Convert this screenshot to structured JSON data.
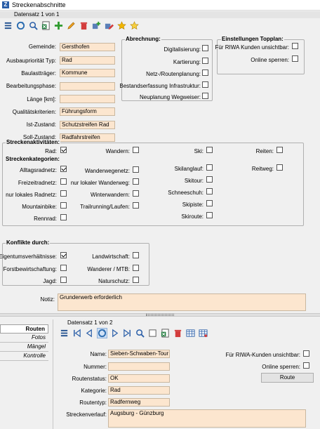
{
  "window": {
    "title": "Streckenabschnitte"
  },
  "top": {
    "record_indicator": "Datensatz 1 von 1",
    "toolbar_icons": [
      "menu-icon",
      "refresh-icon",
      "search-icon",
      "excel-export-icon",
      "add-icon",
      "edit-icon",
      "delete-icon",
      "add-plus-icon",
      "edit-pencil-icon",
      "star-icon",
      "star-outline-icon"
    ]
  },
  "form": {
    "gemeinde": {
      "label": "Gemeinde:",
      "value": "Gersthofen"
    },
    "ausbauprioritaet": {
      "label": "Ausbaupriorität Typ:",
      "value": "Rad"
    },
    "baulasttraeger": {
      "label": "Baulastträger:",
      "value": "Kommune"
    },
    "bearbeitungsphase": {
      "label": "Bearbeitungsphase:",
      "value": ""
    },
    "laenge": {
      "label": "Länge [km]:",
      "value": ""
    },
    "qualitaetskriterien": {
      "label": "Qualitätskriterien:",
      "value": "Führungsform"
    },
    "ist_zustand": {
      "label": "Ist-Zustand:",
      "value": "Schutzstreifen Rad"
    },
    "soll_zustand": {
      "label": "Soll-Zustand:",
      "value": "Radfahrstreifen"
    }
  },
  "abrechnung": {
    "title": "Abrechnung:",
    "items": [
      {
        "label": "Digitalisierung:",
        "checked": false
      },
      {
        "label": "Kartierung:",
        "checked": false
      },
      {
        "label": "Netz-/Routenplanung:",
        "checked": false
      },
      {
        "label": "Bestandserfassung Infrastruktur:",
        "checked": false
      },
      {
        "label": "Neuplanung Wegweiser:",
        "checked": false
      }
    ]
  },
  "toppland": {
    "title": "Einstellungen Topplan:",
    "items": [
      {
        "label": "Für RIWA Kunden unsichtbar:",
        "checked": false
      },
      {
        "label": "Online sperren:",
        "checked": false
      }
    ]
  },
  "streckenaktivitaeten": {
    "title": "Streckenaktivitäten:",
    "rad": {
      "label": "Rad:",
      "checked": true
    },
    "wandern": {
      "label": "Wandern:",
      "checked": false
    },
    "ski": {
      "label": "Ski:",
      "checked": false
    },
    "reiten": {
      "label": "Reiten:",
      "checked": false
    }
  },
  "streckenkategorien": {
    "title": "Streckenkategorien:",
    "col1": [
      {
        "label": "Alltagsradnetz:",
        "checked": true
      },
      {
        "label": "Freizeitradnetz:",
        "checked": false
      },
      {
        "label": "nur lokales Radnetz:",
        "checked": false
      },
      {
        "label": "Mountainbike:",
        "checked": false
      },
      {
        "label": "Rennrad:",
        "checked": false
      }
    ],
    "col2": [
      {
        "label": "Wanderwegenetz:",
        "checked": false
      },
      {
        "label": "nur lokaler Wanderweg:",
        "checked": false
      },
      {
        "label": "Winterwandern:",
        "checked": false
      },
      {
        "label": "Trailrunning/Laufen:",
        "checked": false
      }
    ],
    "col3": [
      {
        "label": "Skilanglauf:",
        "checked": false
      },
      {
        "label": "Skitour:",
        "checked": false
      },
      {
        "label": "Schneeschuh:",
        "checked": false
      },
      {
        "label": "Skipiste:",
        "checked": false
      },
      {
        "label": "Skiroute:",
        "checked": false
      }
    ],
    "col4": [
      {
        "label": "Reitweg:",
        "checked": false
      }
    ]
  },
  "konflikte": {
    "title": "Konflikte durch:",
    "col1": [
      {
        "label": "Eigentumsverhältnisse:",
        "checked": true
      },
      {
        "label": "Forstbewirtschaftung:",
        "checked": false
      },
      {
        "label": "Jagd:",
        "checked": false
      }
    ],
    "col2": [
      {
        "label": "Landwirtschaft:",
        "checked": false
      },
      {
        "label": "Wanderer / MTB:",
        "checked": false
      },
      {
        "label": "Naturschutz:",
        "checked": false
      }
    ]
  },
  "notiz": {
    "label": "Notiz:",
    "value": "Grunderwerb erforderlich"
  },
  "tabs": [
    {
      "label": "Routen",
      "active": true
    },
    {
      "label": "Fotos",
      "active": false
    },
    {
      "label": "Mängel",
      "active": false
    },
    {
      "label": "Kontrolle",
      "active": false
    }
  ],
  "sub": {
    "record_indicator": "Datensatz 1 von 2",
    "name": {
      "label": "Name:",
      "value": "Sieben-Schwaben-Tour"
    },
    "nummer": {
      "label": "Nummer:",
      "value": ""
    },
    "routenstatus": {
      "label": "Routenstatus:",
      "value": "OK"
    },
    "kategorie": {
      "label": "Kategorie:",
      "value": "Rad"
    },
    "routentyp": {
      "label": "Routentyp:",
      "value": "Radfernweg"
    },
    "streckenverlauf": {
      "label": "Streckenverlauf:",
      "value": "Augsburg - Günzburg"
    },
    "riwa_unsichtbar": {
      "label": "Für RIWA-Kunden unsichtbar:",
      "checked": false
    },
    "online_sperren": {
      "label": "Online sperren:",
      "checked": false
    },
    "route_button": "Route"
  },
  "colors": {
    "field_bg": "#fce6cf",
    "accent": "#2b5fa8",
    "delete": "#d33c3c",
    "add": "#2e9a2e",
    "star": "#f2b600"
  }
}
